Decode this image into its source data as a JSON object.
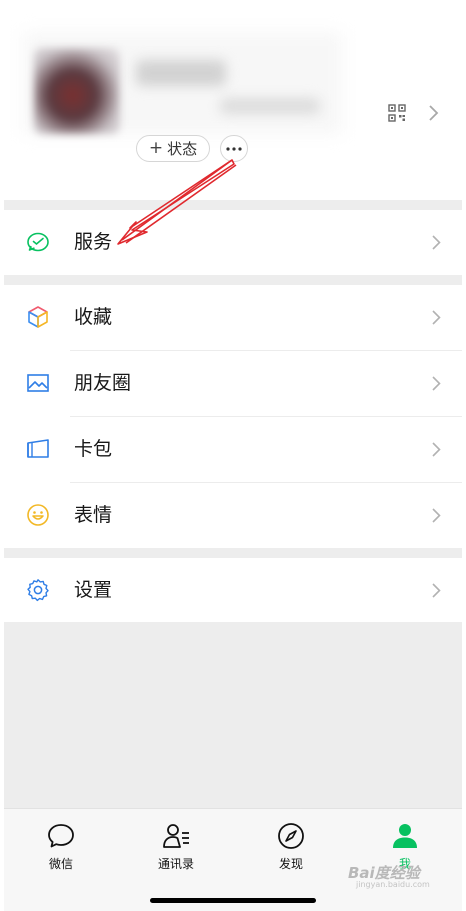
{
  "profile": {
    "status_label": "状态",
    "status_plus": "+"
  },
  "menu": {
    "services": "服务",
    "favorites": "收藏",
    "moments": "朋友圈",
    "cards": "卡包",
    "stickers": "表情",
    "settings": "设置"
  },
  "tabbar": {
    "chats": "微信",
    "contacts": "通讯录",
    "discover": "发现",
    "me": "我"
  },
  "watermark": {
    "brand": "Bai度经验",
    "url": "jingyan.baidu.com"
  },
  "colors": {
    "accent_green": "#07c160",
    "annotation_red": "#e0292e",
    "page_gray": "#ededed"
  },
  "icons": {
    "services": "wechat-pay-icon",
    "favorites": "cube-icon",
    "moments": "picture-icon",
    "cards": "wallet-icon",
    "stickers": "smiley-icon",
    "settings": "gear-icon"
  }
}
